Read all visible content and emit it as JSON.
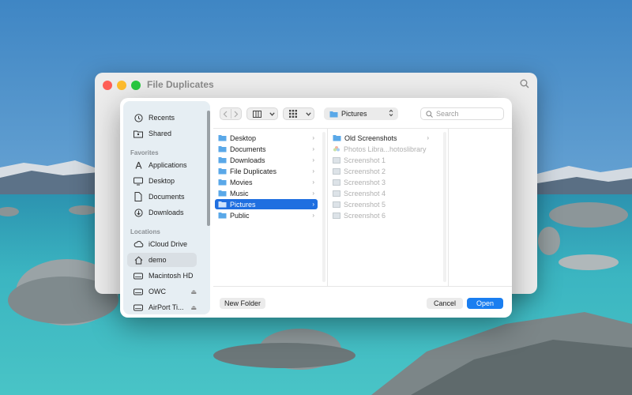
{
  "background_window": {
    "title": "File Duplicates",
    "search_icon": "search-icon"
  },
  "toolbar": {
    "back_icon": "chevron-left-icon",
    "forward_icon": "chevron-right-icon",
    "column_view_icon": "columns-icon",
    "grid_view_icon": "grid-icon",
    "path_popup": "Pictures",
    "search_placeholder": "Search"
  },
  "sidebar": {
    "top_items": [
      {
        "label": "Recents",
        "icon": "clock-icon"
      },
      {
        "label": "Shared",
        "icon": "shared-folder-icon"
      }
    ],
    "favorites_header": "Favorites",
    "favorites": [
      {
        "label": "Applications",
        "icon": "applications-icon"
      },
      {
        "label": "Desktop",
        "icon": "desktop-icon"
      },
      {
        "label": "Documents",
        "icon": "document-icon"
      },
      {
        "label": "Downloads",
        "icon": "download-icon"
      }
    ],
    "locations_header": "Locations",
    "locations": [
      {
        "label": "iCloud Drive",
        "icon": "cloud-icon"
      },
      {
        "label": "demo",
        "icon": "home-icon"
      },
      {
        "label": "Macintosh HD",
        "icon": "disk-icon"
      },
      {
        "label": "OWC",
        "icon": "disk-icon"
      },
      {
        "label": "AirPort Ti...",
        "icon": "disk-icon"
      }
    ]
  },
  "column1": [
    {
      "label": "Desktop",
      "selected": false
    },
    {
      "label": "Documents",
      "selected": false
    },
    {
      "label": "Downloads",
      "selected": false
    },
    {
      "label": "File Duplicates",
      "selected": false
    },
    {
      "label": "Movies",
      "selected": false
    },
    {
      "label": "Music",
      "selected": false
    },
    {
      "label": "Pictures",
      "selected": true
    },
    {
      "label": "Public",
      "selected": false
    }
  ],
  "column2": [
    {
      "label": "Old Screenshots",
      "kind": "folder",
      "has_children": true
    },
    {
      "label": "Photos Libra...hotoslibrary",
      "kind": "photos",
      "has_children": false
    },
    {
      "label": "Screenshot 1",
      "kind": "image",
      "has_children": false
    },
    {
      "label": "Screenshot 2",
      "kind": "image",
      "has_children": false
    },
    {
      "label": "Screenshot 3",
      "kind": "image",
      "has_children": false
    },
    {
      "label": "Screenshot 4",
      "kind": "image",
      "has_children": false
    },
    {
      "label": "Screenshot 5",
      "kind": "image",
      "has_children": false
    },
    {
      "label": "Screenshot 6",
      "kind": "image",
      "has_children": false
    }
  ],
  "buttons": {
    "new_folder": "New Folder",
    "cancel": "Cancel",
    "open": "Open"
  },
  "colors": {
    "accent": "#1a7ef0",
    "selection": "#1f6fe0",
    "folder": "#5aa8e8"
  }
}
